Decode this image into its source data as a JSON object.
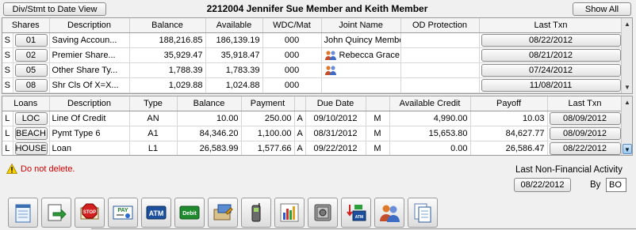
{
  "header": {
    "div_stmt_label": "Div/Stmt to Date View",
    "title": "2212004  Jennifer Sue Member and Keith Member",
    "show_all_label": "Show All"
  },
  "shares": {
    "columns": [
      "Shares",
      "Description",
      "Balance",
      "Available",
      "WDC/Mat",
      "Joint Name",
      "OD Protection",
      "Last Txn"
    ],
    "rows": [
      {
        "type": "S",
        "id": "01",
        "description": "Saving Accoun...",
        "balance": "188,216.85",
        "available": "186,139.19",
        "wdc": "000",
        "joint": "John Quincy Member",
        "joint_icon": "",
        "od": "",
        "last_txn": "08/22/2012"
      },
      {
        "type": "S",
        "id": "02",
        "description": "Premier Share...",
        "balance": "35,929.47",
        "available": "35,918.47",
        "wdc": "000",
        "joint": "Rebecca Grace...",
        "joint_icon": "people-icon",
        "od": "",
        "last_txn": "08/21/2012"
      },
      {
        "type": "S",
        "id": "05",
        "description": "Other Share Ty...",
        "balance": "1,788.39",
        "available": "1,783.39",
        "wdc": "000",
        "joint": "",
        "joint_icon": "people-icon",
        "od": "",
        "last_txn": "07/24/2012"
      },
      {
        "type": "S",
        "id": "08",
        "description": "Shr Cls Of X=X...",
        "balance": "1,029.88",
        "available": "1,024.88",
        "wdc": "000",
        "joint": "",
        "joint_icon": "",
        "od": "",
        "last_txn": "11/08/2011"
      }
    ]
  },
  "loans": {
    "columns": [
      "Loans",
      "Description",
      "Type",
      "Balance",
      "Payment",
      "",
      "Due Date",
      "",
      "Available Credit",
      "Payoff",
      "Last Txn"
    ],
    "rows": [
      {
        "type": "L",
        "id": "LOC",
        "description": "Line Of Credit",
        "loan_type": "AN",
        "balance": "10.00",
        "payment": "250.00",
        "flag1": "A",
        "due_date": "09/10/2012",
        "flag2": "M",
        "available_credit": "4,990.00",
        "payoff": "10.03",
        "last_txn": "08/09/2012"
      },
      {
        "type": "L",
        "id": "BEACH",
        "description": "Pymt Type 6",
        "loan_type": "A1",
        "balance": "84,346.20",
        "payment": "1,100.00",
        "flag1": "A",
        "due_date": "08/31/2012",
        "flag2": "M",
        "available_credit": "15,653.80",
        "payoff": "84,627.77",
        "last_txn": "08/09/2012"
      },
      {
        "type": "L",
        "id": "HOUSE",
        "description": "Loan",
        "loan_type": "L1",
        "balance": "26,583.99",
        "payment": "1,577.66",
        "flag1": "A",
        "due_date": "09/22/2012",
        "flag2": "M",
        "available_credit": "0.00",
        "payoff": "26,586.47",
        "last_txn": "08/22/2012"
      }
    ]
  },
  "warning": {
    "text": "Do not delete.",
    "icon": "warning-icon"
  },
  "activity": {
    "label": "Last Non-Financial Activity",
    "date": "08/22/2012",
    "by_label": "By",
    "by_value": "BO"
  },
  "toolbar": {
    "icons": [
      "notepad-icon",
      "transfer-icon",
      "stop-icon",
      "pay-icon",
      "atm-icon",
      "debit-icon",
      "card-edit-icon",
      "phone-icon",
      "chart-icon",
      "safe-icon",
      "atm-transfer-icon",
      "people-icon",
      "documents-icon"
    ],
    "labels": {
      "pay": "PAY",
      "atm": "ATM",
      "debit": "Debit",
      "stop": "STOP",
      "atm_small": "ATM"
    }
  }
}
